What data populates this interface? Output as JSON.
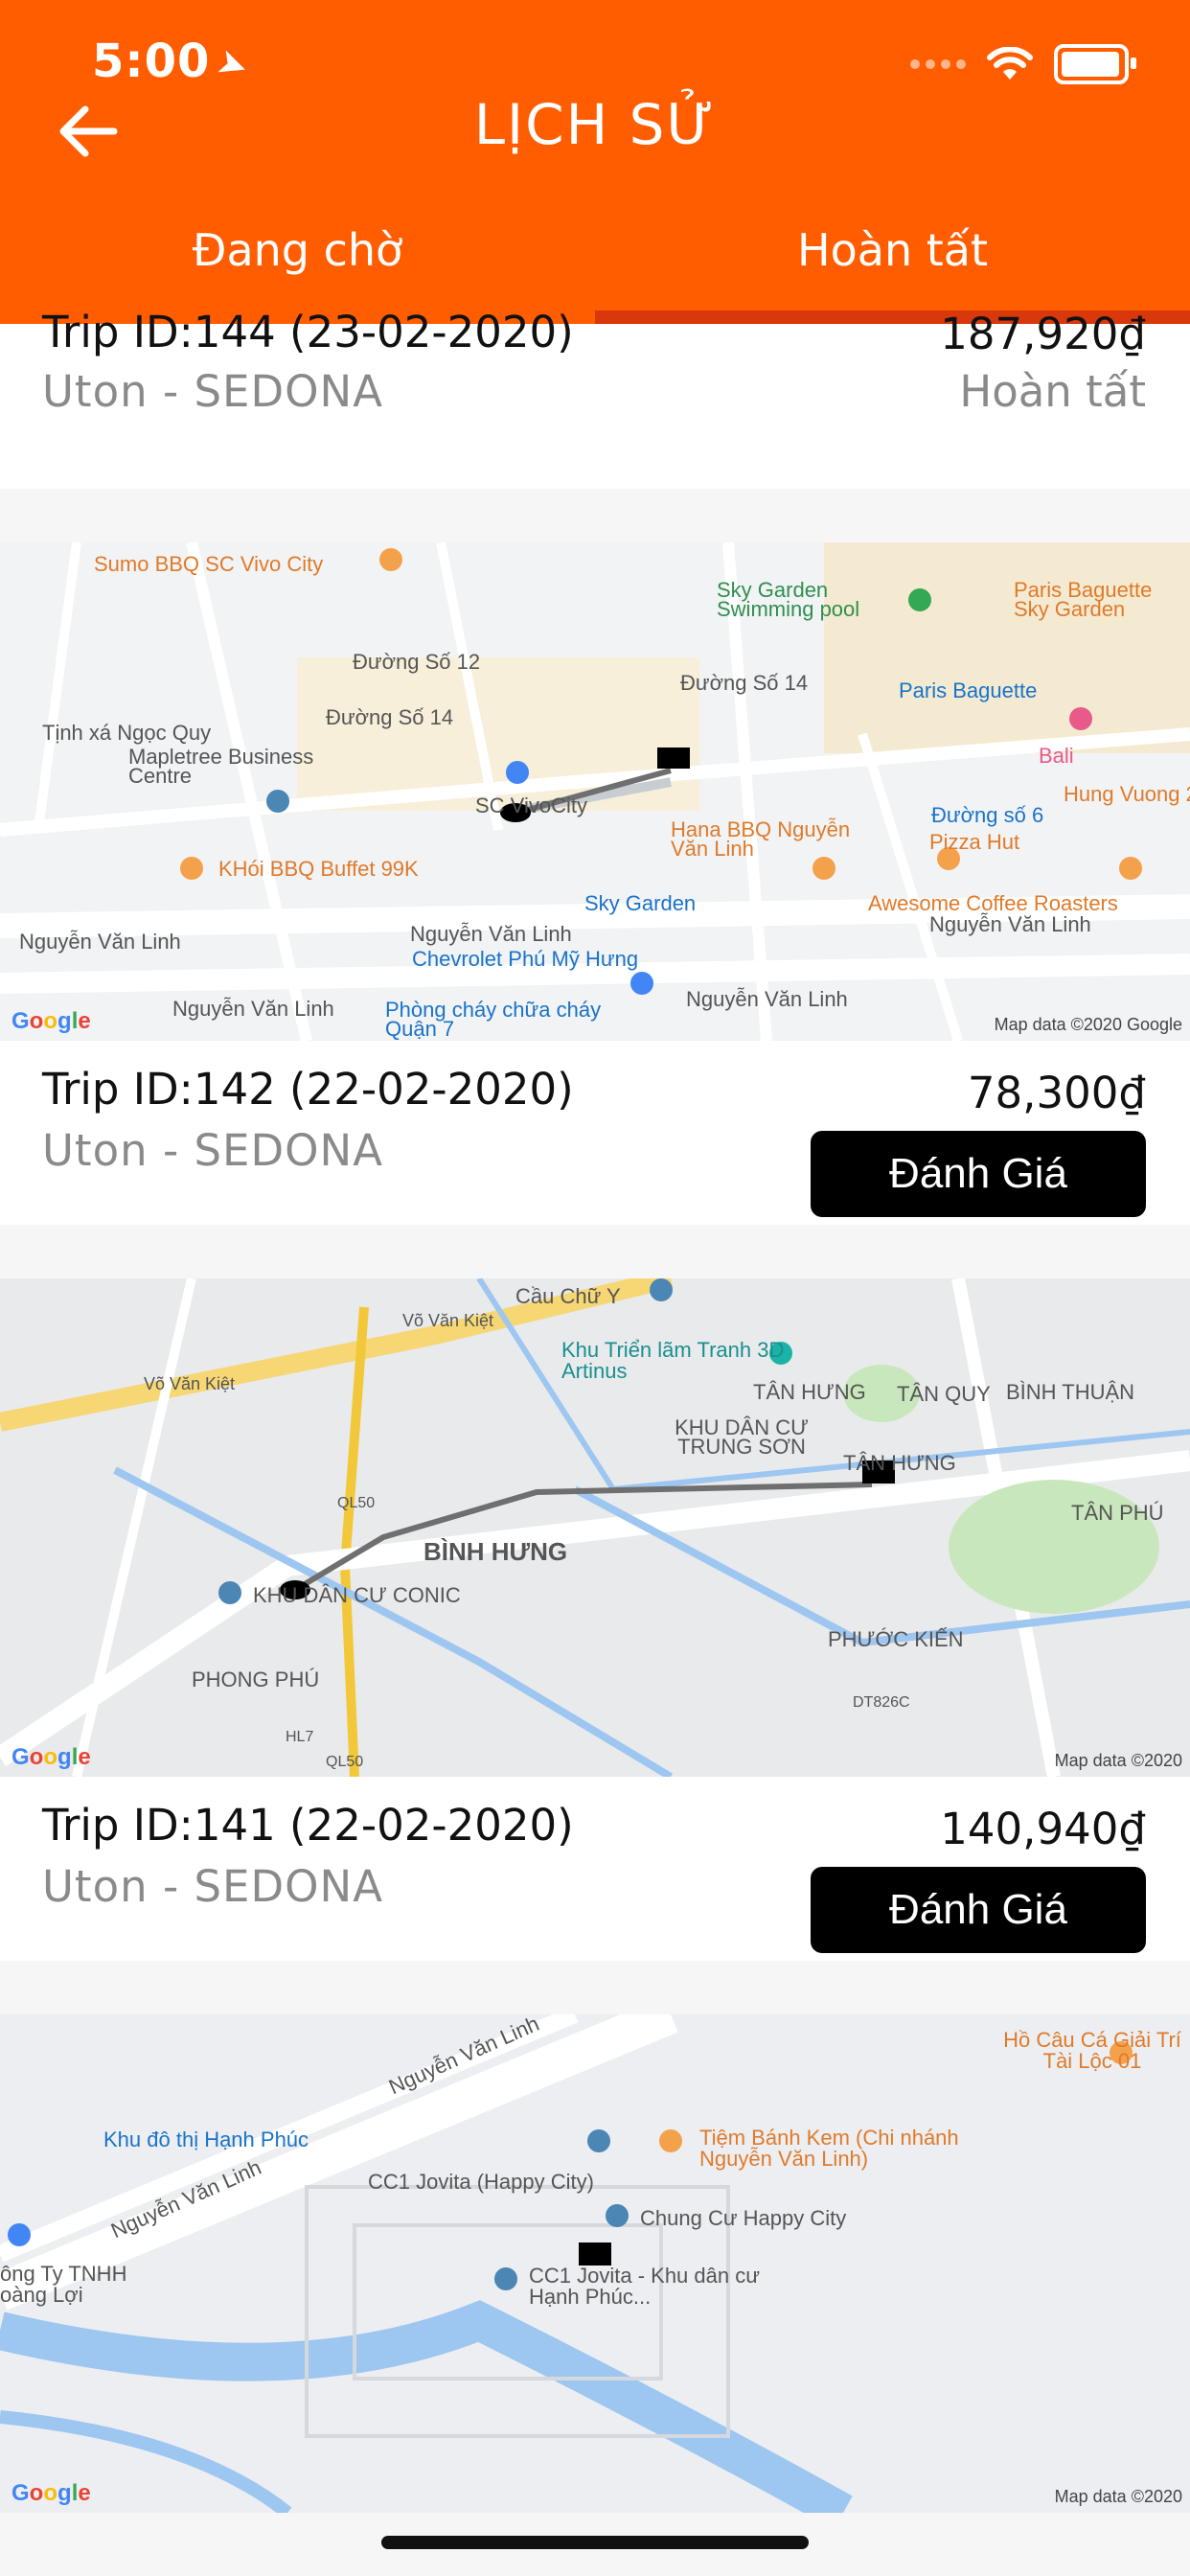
{
  "status_bar": {
    "time": "5:00"
  },
  "header": {
    "title": "LỊCH SỬ"
  },
  "tabs": [
    {
      "label": "Đang chờ"
    },
    {
      "label": "Hoàn tất"
    }
  ],
  "colors": {
    "brand": "#ff5d00",
    "tab_indicator": "#d8380c",
    "button": "#000000"
  },
  "trips": [
    {
      "trip_id": "Trip ID:144 (23-02-2020)",
      "route": "Uton - SEDONA",
      "price": "187,920₫",
      "status": "Hoàn tất"
    },
    {
      "trip_id": "Trip ID:142 (22-02-2020)",
      "route": "Uton - SEDONA",
      "price": "78,300₫",
      "action": "Đánh Giá"
    },
    {
      "trip_id": "Trip ID:141 (22-02-2020)",
      "route": "Uton - SEDONA",
      "price": "140,940₫",
      "action": "Đánh Giá"
    }
  ],
  "maps": [
    {
      "labels": [
        "Sumo BBQ SC Vivo City",
        "Sky Garden Swimming pool",
        "Paris Baguette Sky Garden",
        "Tịnh xá Ngọc Quy",
        "Mapletree Business Centre",
        "Paris Baguette",
        "Bali",
        "Hung Vuong 2",
        "SC VivoCity",
        "Hana BBQ Nguyễn Văn Linh",
        "Đường số 6",
        "Pizza Hut",
        "KHói BBQ Buffet 99K",
        "Sky Garden",
        "Awesome Coffee Roasters",
        "Nguyễn Văn Linh",
        "Nguyễn Văn Linh",
        "Nguyễn Văn Linh",
        "Chevrolet Phú Mỹ Hưng",
        "Nguyễn Văn Linh",
        "Phòng cháy chữa cháy Quận 7",
        "Nguyễn Văn Linh",
        "Đường Số 12",
        "Đường Số 14",
        "Đường Số 14"
      ],
      "attribution": "Map data ©2020 Google"
    },
    {
      "labels": [
        "Cầu Chữ Y",
        "Võ Văn Kiệt",
        "Khu Triển lãm Tranh 3D Artinus",
        "TÂN HƯNG",
        "TÂN QUY",
        "BÌNH THUẬN",
        "KHU DÂN CƯ TRUNG SƠN",
        "TÂN HƯNG",
        "TÂN PHÚ",
        "BÌNH HƯNG",
        "KHU DÂN CƯ CONIC",
        "PHƯỚC KIẾN",
        "PHONG PHÚ",
        "Võ Văn Kiệt",
        "QL50",
        "DT826C",
        "HL7",
        "QL50"
      ],
      "attribution": "Map data ©2020"
    },
    {
      "labels": [
        "Hồ Câu Cá Giải Trí Tài Lộc 01",
        "Nguyễn Văn Linh",
        "Khu đô thị Hạnh Phúc",
        "Tiệm Bánh Kem (Chi nhánh Nguyễn Văn Linh)",
        "CC1 Jovita (Happy City)",
        "Chung Cư Happy City",
        "Nguyễn Văn Linh",
        "ông Ty TNHH oàng Lợi",
        "CC1 Jovita - Khu dân cư Hạnh Phúc..."
      ],
      "attribution": "Map data ©2020"
    }
  ],
  "google_logo": "Google"
}
